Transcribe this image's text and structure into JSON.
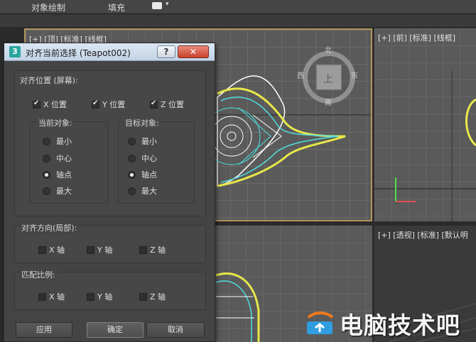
{
  "ribbon": {
    "item1": "对象绘制",
    "item2": "填充",
    "dropdown_arrow": "▾"
  },
  "viewports": {
    "top_label": "[+] [顶] [标准] [线框]",
    "front_label": "[+] [前] [标准] [线框]",
    "persp_label": "[+] [透视] [标准] [默认明",
    "viewcube": {
      "face": "上",
      "north": "北",
      "south": "南",
      "west": "西",
      "east": "东"
    }
  },
  "dialog": {
    "title": "对齐当前选择 (Teapot002)",
    "help": "?",
    "close": "✕",
    "app_icon": "3",
    "align_position_label": "对齐位置 (屏幕):",
    "x_pos": "X 位置",
    "y_pos": "Y 位置",
    "z_pos": "Z 位置",
    "current_obj_label": "当前对象:",
    "target_obj_label": "目标对象:",
    "opt_min": "最小",
    "opt_center": "中心",
    "opt_pivot": "轴点",
    "opt_max": "最大",
    "align_orient_label": "对齐方向(局部):",
    "match_scale_label": "匹配比例:",
    "x_axis": "X 轴",
    "y_axis": "Y 轴",
    "z_axis": "Z 轴",
    "apply": "应用",
    "ok": "确定",
    "cancel": "取消"
  },
  "watermark": {
    "text": "电脑技术吧"
  },
  "colors": {
    "active_viewport_border": "#b0955a",
    "wire_yellow": "#e8e84a",
    "wire_cyan": "#4fe0e0",
    "close_red": "#c8412b"
  }
}
